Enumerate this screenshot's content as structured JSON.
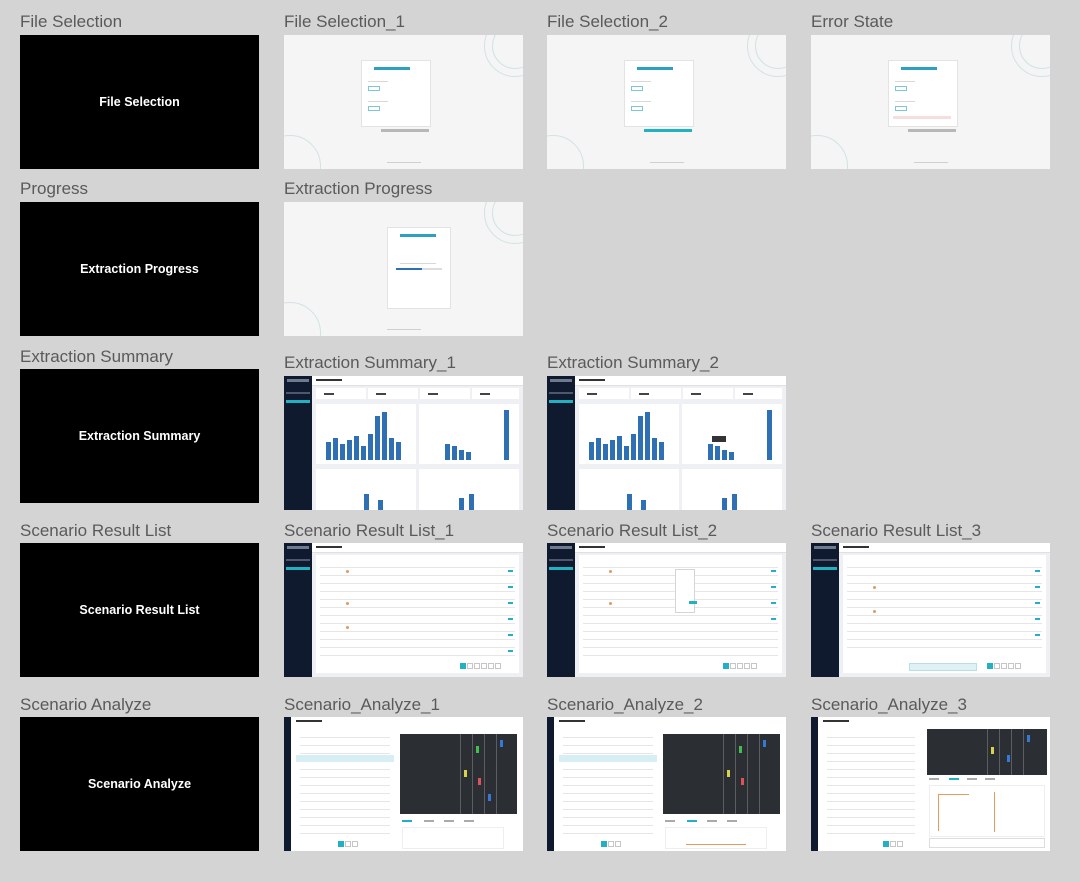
{
  "sections": [
    {
      "label": "File Selection",
      "frames": [
        "File Selection_1",
        "File Selection_2",
        "Error State"
      ],
      "summary_frame_text": "File Selection"
    },
    {
      "label": "Progress",
      "frames": [
        "Extraction Progress"
      ],
      "summary_frame_text": "Extraction Progress"
    },
    {
      "label": "Extraction Summary",
      "frames": [
        "Extraction Summary_1",
        "Extraction Summary_2"
      ],
      "summary_frame_text": "Extraction Summary"
    },
    {
      "label": "Scenario Result List",
      "frames": [
        "Scenario Result List_1",
        "Scenario Result List_2",
        "Scenario Result List_3"
      ],
      "summary_frame_text": "Scenario Result List"
    },
    {
      "label": "Scenario Analyze",
      "frames": [
        "Scenario_Analyze_1",
        "Scenario_Analyze_2",
        "Scenario_Analyze_3"
      ],
      "summary_frame_text": "Scenario Analyze"
    }
  ],
  "colors": {
    "canvas": "#d4d4d4",
    "accent": "#21b1c3",
    "sidebar": "#101a2e",
    "bar": "#2f6fb4"
  }
}
